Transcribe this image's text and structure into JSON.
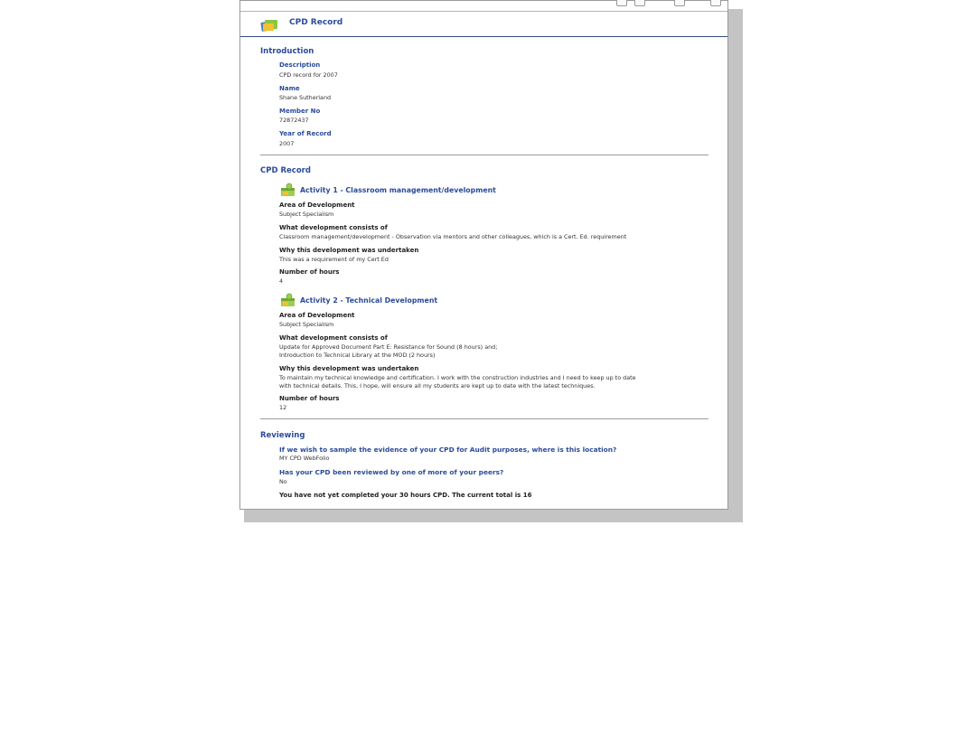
{
  "header": {
    "title": "CPD Record"
  },
  "introduction": {
    "heading": "Introduction",
    "fields": [
      {
        "label": "Description",
        "value": "CPD record for 2007"
      },
      {
        "label": "Name",
        "value": "Shane Sutherland"
      },
      {
        "label": "Member No",
        "value": "72872437"
      },
      {
        "label": "Year of Record",
        "value": "2007"
      }
    ]
  },
  "cpd": {
    "heading": "CPD Record",
    "activities": [
      {
        "title": "Activity 1 - Classroom management/development",
        "area_label": "Area of Development",
        "area_value": "Subject Specialism",
        "consists_label": "What development consists of",
        "consists_lines": [
          "Classroom management/development - Observation via mentors and other colleagues, which is a Cert. Ed. requirement"
        ],
        "why_label": "Why this development was undertaken",
        "why_lines": [
          "This was a requirement of my Cert Ed"
        ],
        "hours_label": "Number of hours",
        "hours_value": "4"
      },
      {
        "title": "Activity 2 - Technical Development",
        "area_label": "Area of Development",
        "area_value": "Subject Specialism",
        "consists_label": "What development consists of",
        "consists_lines": [
          "Update for Approved Document Part E: Resistance for Sound (8 hours) and;",
          "Introduction to Technical Library at the MOD (2 hours)"
        ],
        "why_label": "Why this development was undertaken",
        "why_lines": [
          "To maintain my technical knowledge and certification. I work with the construction industries and I need to keep up to date",
          "with technical details. This, I hope, will ensure all my students are kept up to date with the latest techniques."
        ],
        "hours_label": "Number of hours",
        "hours_value": "12"
      }
    ]
  },
  "reviewing": {
    "heading": "Reviewing",
    "q1": "If we wish to sample the evidence of your CPD for Audit purposes, where is this location?",
    "a1": "MY CPD WebFolio",
    "q2": "Has your CPD been reviewed by one of more of your peers?",
    "a2": "No",
    "note": "You have not yet completed your 30 hours CPD. The current total is 16"
  }
}
